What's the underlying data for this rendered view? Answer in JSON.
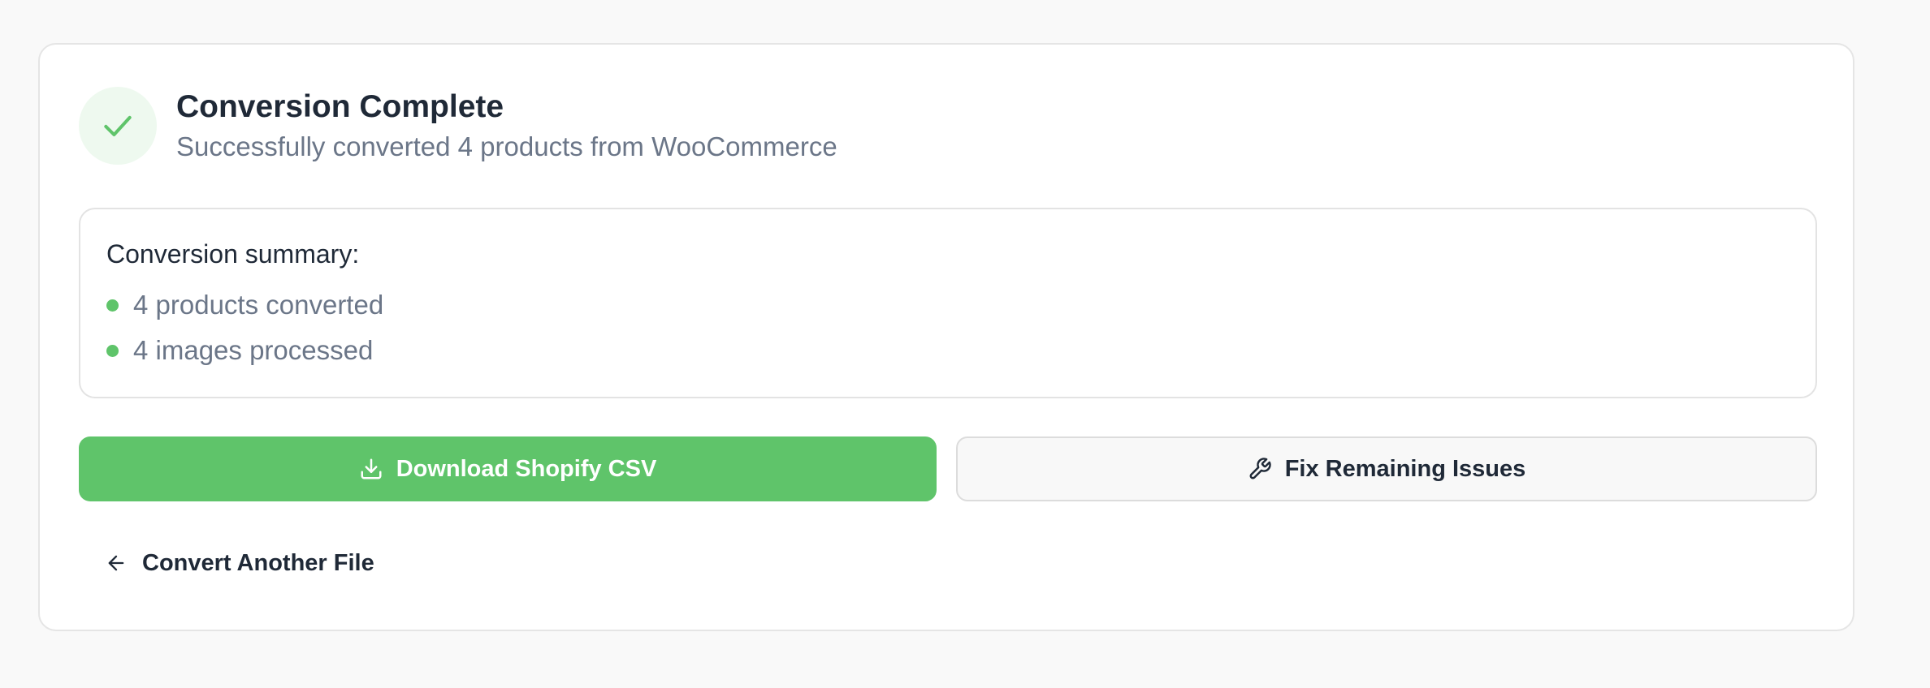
{
  "header": {
    "title": "Conversion Complete",
    "subtitle": "Successfully converted 4 products from WooCommerce",
    "status_icon": "check-icon"
  },
  "summary": {
    "heading": "Conversion summary:",
    "items": [
      {
        "label": "4 products converted"
      },
      {
        "label": "4 images processed"
      }
    ]
  },
  "actions": {
    "download_label": "Download Shopify CSV",
    "download_icon": "download-icon",
    "fix_label": "Fix Remaining Issues",
    "fix_icon": "wrench-icon",
    "back_label": "Convert Another File",
    "back_icon": "arrow-left-icon"
  },
  "colors": {
    "accent": "#5fc46a",
    "accent_soft": "#eef9ef",
    "text_primary": "#1f2937",
    "text_muted": "#6b7688",
    "page_bg": "#f9f9f9"
  }
}
